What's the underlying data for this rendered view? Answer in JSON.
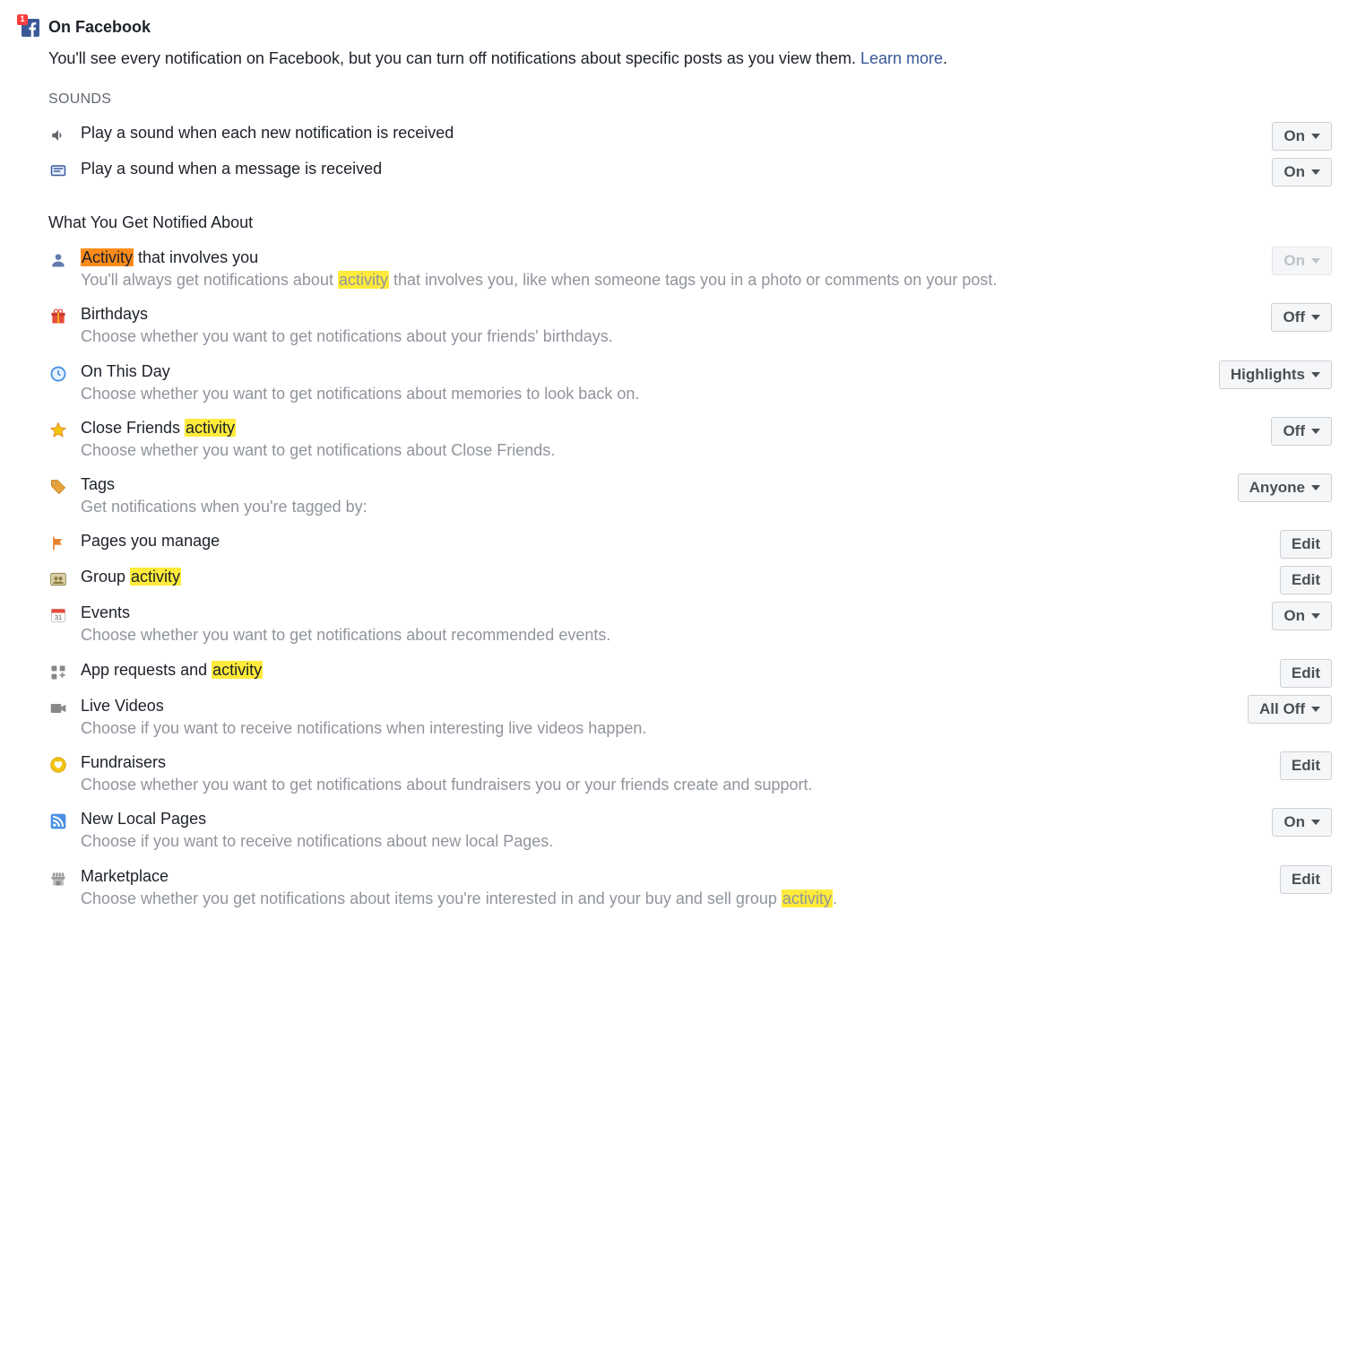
{
  "header": {
    "title": "On Facebook",
    "badge": "1"
  },
  "intro": {
    "text": "You'll see every notification on Facebook, but you can turn off notifications about specific posts as you view them. ",
    "link": "Learn more",
    "period": "."
  },
  "sections": {
    "sounds_label": "SOUNDS",
    "notified_label": "What You Get Notified About"
  },
  "sounds": {
    "notification": {
      "label": "Play a sound when each new notification is received",
      "value": "On"
    },
    "message": {
      "label": "Play a sound when a message is received",
      "value": "On"
    }
  },
  "items": {
    "activity": {
      "title_pre_hl": "",
      "title_hl": "Activity",
      "title_post_hl": " that involves you",
      "desc_pre": "You'll always get notifications about ",
      "desc_hl": "activity",
      "desc_post": " that involves you, like when someone tags you in a photo or comments on your post.",
      "value": "On"
    },
    "birthdays": {
      "title": "Birthdays",
      "desc": "Choose whether you want to get notifications about your friends' birthdays.",
      "value": "Off"
    },
    "onthisday": {
      "title": "On This Day",
      "desc": "Choose whether you want to get notifications about memories to look back on.",
      "value": "Highlights"
    },
    "closefriends": {
      "title_pre": "Close Friends ",
      "title_hl": "activity",
      "desc": "Choose whether you want to get notifications about Close Friends.",
      "value": "Off"
    },
    "tags": {
      "title": "Tags",
      "desc": "Get notifications when you're tagged by:",
      "value": "Anyone"
    },
    "pages": {
      "title": "Pages you manage",
      "value": "Edit"
    },
    "group": {
      "title_pre": "Group ",
      "title_hl": "activity",
      "value": "Edit"
    },
    "events": {
      "title": "Events",
      "desc": "Choose whether you want to get notifications about recommended events.",
      "value": "On"
    },
    "apps": {
      "title_pre": "App requests and ",
      "title_hl": "activity",
      "value": "Edit"
    },
    "live": {
      "title": "Live Videos",
      "desc": "Choose if you want to receive notifications when interesting live videos happen.",
      "value": "All Off"
    },
    "fundraisers": {
      "title": "Fundraisers",
      "desc": "Choose whether you want to get notifications about fundraisers you or your friends create and support.",
      "value": "Edit"
    },
    "localpages": {
      "title": "New Local Pages",
      "desc": "Choose if you want to receive notifications about new local Pages.",
      "value": "On"
    },
    "marketplace": {
      "title": "Marketplace",
      "desc_pre": "Choose whether you get notifications about items you're interested in and your buy and sell group ",
      "desc_hl": "activity",
      "desc_post": ".",
      "value": "Edit"
    }
  }
}
